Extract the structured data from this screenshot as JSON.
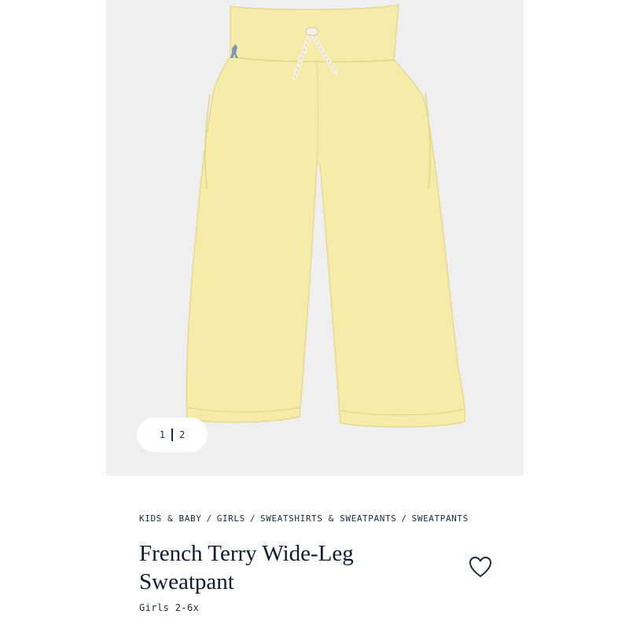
{
  "gallery": {
    "pager": {
      "current": "1",
      "total": "2"
    },
    "image": {
      "garment_color": "#f6ecaa",
      "logo_color": "#7d97b6"
    }
  },
  "breadcrumb": {
    "items": [
      "KIDS & BABY",
      "GIRLS",
      "SWEATSHIRTS & SWEATPANTS",
      "SWEATPANTS"
    ],
    "separator": "/"
  },
  "product": {
    "title": "French Terry Wide-Leg Sweatpant",
    "subtitle": "Girls 2-6x"
  },
  "icons": {
    "wishlist": "heart-icon"
  },
  "colors": {
    "text": "#1b2a41",
    "background": "#efefef"
  }
}
